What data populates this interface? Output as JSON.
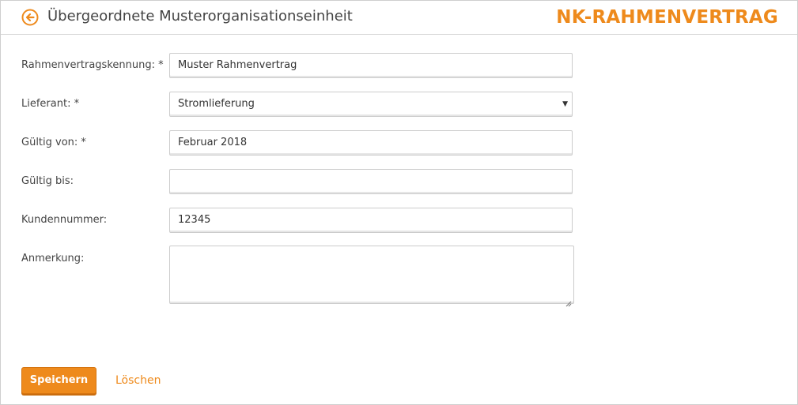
{
  "header": {
    "title": "Übergeordnete Musterorganisationseinheit",
    "brand": "NK-RAHMENVERTRAG",
    "back_icon": "arrow-left-circle-icon",
    "accent_color": "#ee8a1c"
  },
  "form": {
    "fields": [
      {
        "label": "Rahmenvertragskennung: *",
        "value": "Muster Rahmenvertrag",
        "type": "text"
      },
      {
        "label": "Lieferant: *",
        "value": "Stromlieferung",
        "type": "select"
      },
      {
        "label": "Gültig von: *",
        "value": "Februar 2018",
        "type": "text"
      },
      {
        "label": "Gültig bis:",
        "value": "",
        "type": "text"
      },
      {
        "label": "Kundennummer:",
        "value": "12345",
        "type": "text"
      },
      {
        "label": "Anmerkung:",
        "value": "",
        "type": "textarea"
      }
    ]
  },
  "actions": {
    "save_label": "Speichern",
    "delete_label": "Löschen"
  }
}
